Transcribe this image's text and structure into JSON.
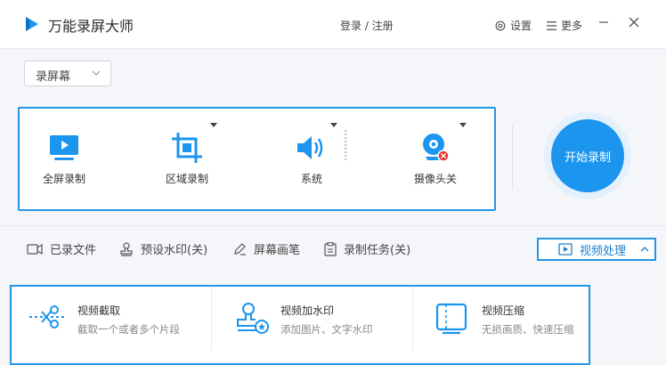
{
  "app": {
    "title": "万能录屏大师"
  },
  "header": {
    "login_label": "登录 / 注册",
    "settings_label": "设置",
    "more_label": "更多"
  },
  "mode_select": {
    "value": "录屏幕"
  },
  "sources": [
    {
      "label": "全屏录制",
      "icon": "monitor-icon"
    },
    {
      "label": "区域录制",
      "icon": "crop-icon"
    },
    {
      "label": "系统",
      "icon": "speaker-icon"
    },
    {
      "label": "摄像头关",
      "icon": "webcam-icon"
    }
  ],
  "start_button": {
    "label": "开始录制"
  },
  "toolbar": {
    "recorded_files": "已录文件",
    "watermark_preset": "预设水印(关)",
    "screen_brush": "屏幕画笔",
    "record_tasks": "录制任务(关)",
    "video_processing": "视频处理"
  },
  "tools": [
    {
      "name": "视频截取",
      "desc": "截取一个或者多个片段",
      "icon": "scissors-icon"
    },
    {
      "name": "视频加水印",
      "desc": "添加图片、文字水印",
      "icon": "stamp-icon"
    },
    {
      "name": "视频压缩",
      "desc": "无损画质、快速压缩",
      "icon": "compress-icon"
    }
  ],
  "colors": {
    "accent": "#1c95ee",
    "panel_border": "#2496e6",
    "close_badge": "#e53935"
  }
}
